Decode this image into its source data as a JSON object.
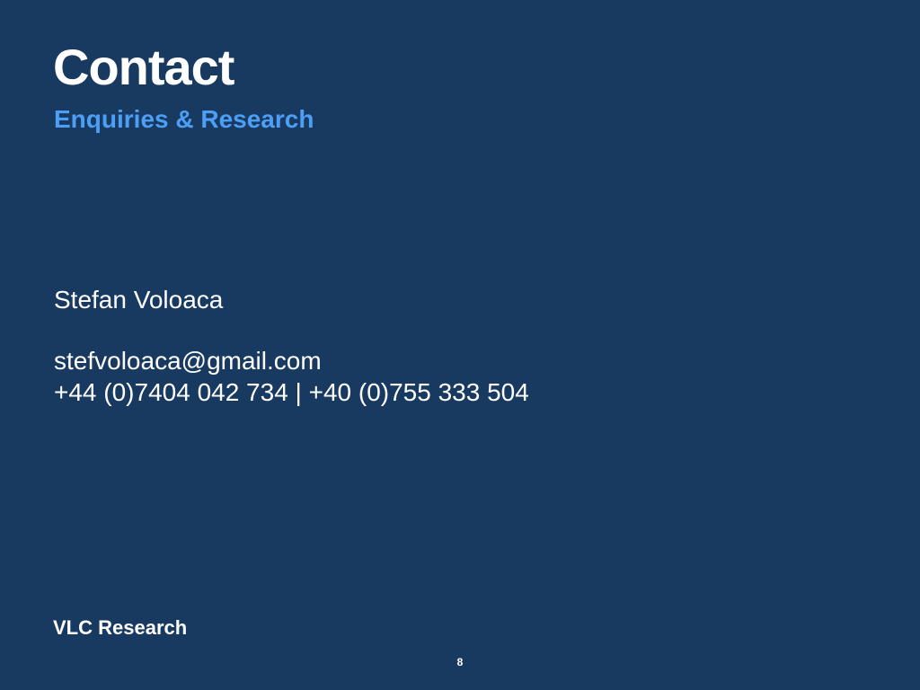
{
  "slide": {
    "title": "Contact",
    "subtitle": "Enquiries & Research",
    "contact": {
      "name": "Stefan Voloaca",
      "email": "stefvoloaca@gmail.com",
      "phones": "+44 (0)7404 042 734 | +40 (0)755 333 504"
    },
    "footer_brand": "VLC Research",
    "page_number": "8"
  },
  "colors": {
    "background": "#183a61",
    "text": "#ffffff",
    "accent": "#4d9ef5"
  }
}
